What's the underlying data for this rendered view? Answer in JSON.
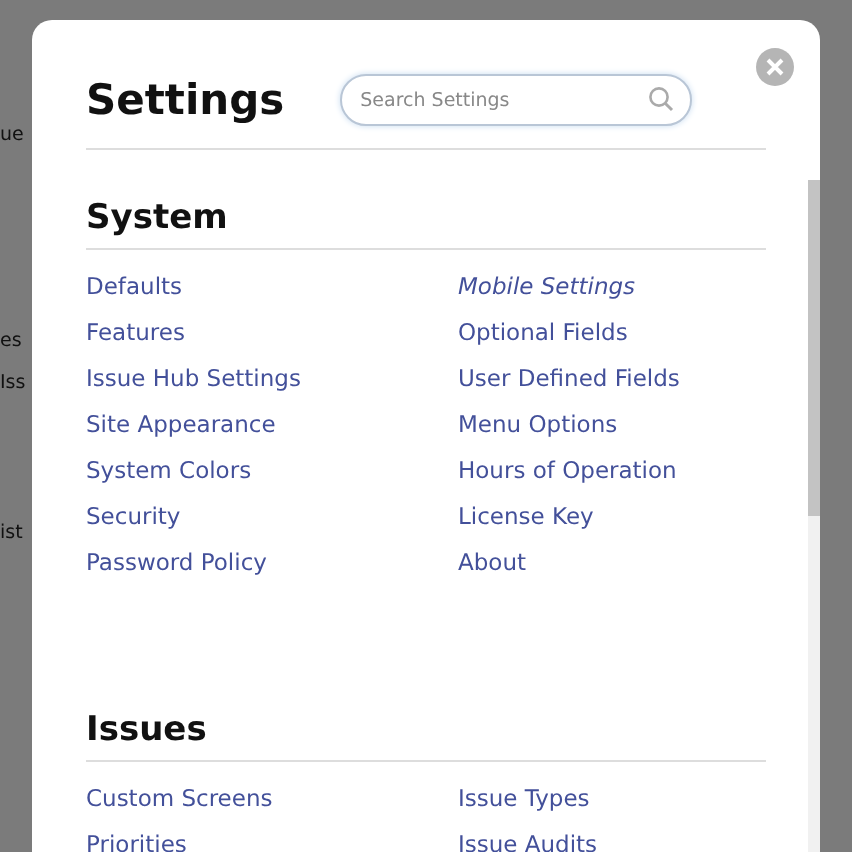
{
  "background": {
    "fragments": [
      "ue",
      "es",
      "Iss",
      "ist"
    ]
  },
  "dialog": {
    "title": "Settings",
    "search": {
      "placeholder": "Search Settings"
    },
    "sections": [
      {
        "heading": "System",
        "columns": [
          [
            {
              "label": "Defaults",
              "italic": false
            },
            {
              "label": "Features",
              "italic": false
            },
            {
              "label": "Issue Hub Settings",
              "italic": false
            },
            {
              "label": "Site Appearance",
              "italic": false
            },
            {
              "label": "System Colors",
              "italic": false
            },
            {
              "label": "Security",
              "italic": false
            },
            {
              "label": "Password Policy",
              "italic": false
            }
          ],
          [
            {
              "label": "Mobile Settings",
              "italic": true
            },
            {
              "label": "Optional Fields",
              "italic": false
            },
            {
              "label": "User Defined Fields",
              "italic": false
            },
            {
              "label": "Menu Options",
              "italic": false
            },
            {
              "label": "Hours of Operation",
              "italic": false
            },
            {
              "label": "License Key",
              "italic": false
            },
            {
              "label": "About",
              "italic": false
            }
          ]
        ]
      },
      {
        "heading": "Issues",
        "columns": [
          [
            {
              "label": "Custom Screens",
              "italic": false
            },
            {
              "label": "Priorities",
              "italic": false
            }
          ],
          [
            {
              "label": "Issue Types",
              "italic": false
            },
            {
              "label": "Issue Audits",
              "italic": false
            }
          ]
        ]
      }
    ]
  }
}
